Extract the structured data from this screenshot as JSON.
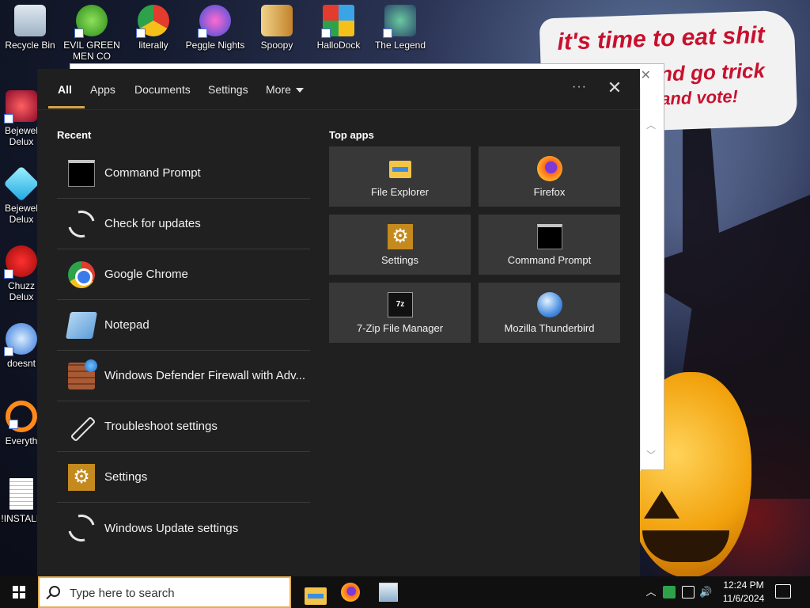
{
  "wallpaper": {
    "speech_line1": "it's time to eat shit",
    "speech_line2": "nd go trick",
    "speech_line3": "and vote!"
  },
  "desktop_icons": [
    {
      "label": "Recycle Bin",
      "icon": "recycle-bin-icon"
    },
    {
      "label": "EVIL GREEN MEN CO",
      "icon": "green-men-icon"
    },
    {
      "label": "literally",
      "icon": "chrome-icon"
    },
    {
      "label": "Peggle Nights",
      "icon": "peggle-icon"
    },
    {
      "label": "Spoopy",
      "icon": "spoopy-icon"
    },
    {
      "label": "HalloDock",
      "icon": "windows-logo-icon"
    },
    {
      "label": "The Legend",
      "icon": "legend-game-icon"
    },
    {
      "label": "Bejewel Delux",
      "icon": "bejeweled-icon"
    },
    {
      "label": "Bejewel Delux",
      "icon": "bejeweled-diamond-icon"
    },
    {
      "label": "Chuzz Delux",
      "icon": "chuzzle-icon"
    },
    {
      "label": "doesnt",
      "icon": "thunderbird-icon"
    },
    {
      "label": "Everyth",
      "icon": "everything-search-icon"
    },
    {
      "label": "!INSTALL",
      "icon": "text-file-icon"
    }
  ],
  "search": {
    "tabs": [
      {
        "label": "All"
      },
      {
        "label": "Apps"
      },
      {
        "label": "Documents"
      },
      {
        "label": "Settings"
      },
      {
        "label": "More"
      }
    ],
    "more_options": "···",
    "close": "✕",
    "recent_title": "Recent",
    "top_apps_title": "Top apps",
    "recent": [
      {
        "label": "Command Prompt",
        "icon": "command-prompt-icon"
      },
      {
        "label": "Check for updates",
        "icon": "sync-icon"
      },
      {
        "label": "Google Chrome",
        "icon": "chrome-icon"
      },
      {
        "label": "Notepad",
        "icon": "notepad-icon"
      },
      {
        "label": "Windows Defender Firewall with Adv...",
        "icon": "firewall-icon"
      },
      {
        "label": "Troubleshoot settings",
        "icon": "wrench-icon"
      },
      {
        "label": "Settings",
        "icon": "gear-icon"
      },
      {
        "label": "Windows Update settings",
        "icon": "sync-icon"
      }
    ],
    "top_apps": [
      {
        "label": "File Explorer",
        "icon": "folder-icon"
      },
      {
        "label": "Firefox",
        "icon": "firefox-icon"
      },
      {
        "label": "Settings",
        "icon": "gear-icon"
      },
      {
        "label": "Command Prompt",
        "icon": "command-prompt-icon"
      },
      {
        "label": "7-Zip File Manager",
        "icon": "7zip-icon"
      },
      {
        "label": "Mozilla Thunderbird",
        "icon": "thunderbird-icon"
      }
    ]
  },
  "taskbar": {
    "search_placeholder": "Type here to search",
    "gear_symbol": "⚙",
    "zip_symbol": "7z",
    "tray_chevron": "︿",
    "tray_speaker": "🔊",
    "time": "12:24 PM",
    "date": "11/6/2024"
  },
  "colors": {
    "accent": "#d8a24a",
    "panel_bg": "#202020",
    "tile_bg": "#383838",
    "speech_text": "#c8102e"
  }
}
